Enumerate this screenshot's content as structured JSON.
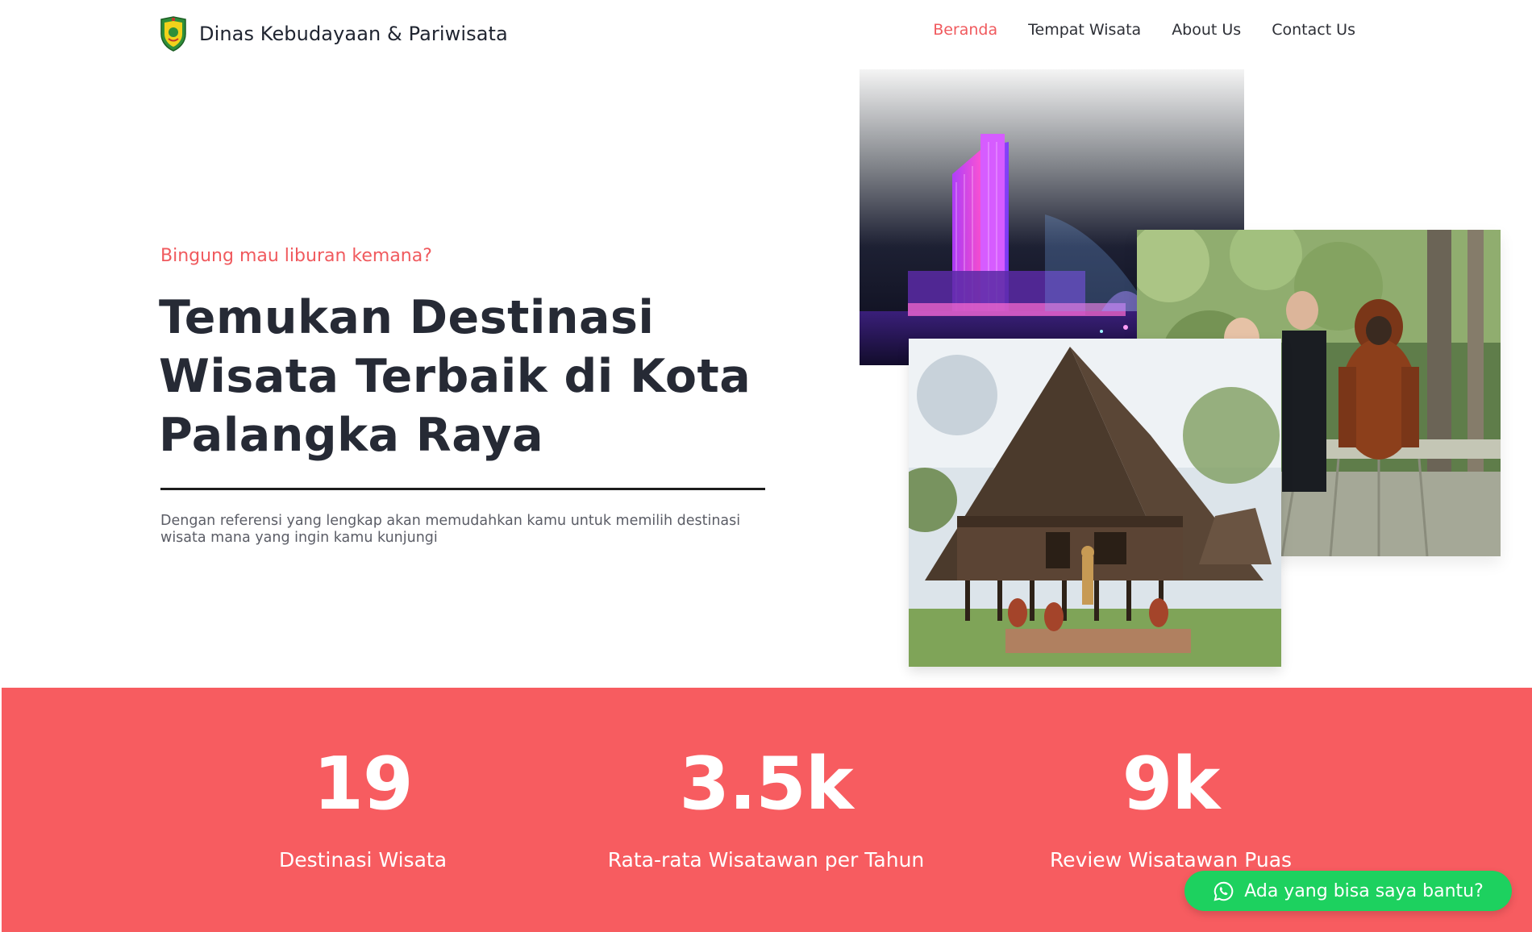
{
  "header": {
    "brand_name": "Dinas Kebudayaan & Pariwisata",
    "nav": [
      {
        "label": "Beranda",
        "active": true
      },
      {
        "label": "Tempat Wisata",
        "active": false
      },
      {
        "label": "About Us",
        "active": false
      },
      {
        "label": "Contact Us",
        "active": false
      }
    ]
  },
  "hero": {
    "eyebrow": "Bingung mau liburan kemana?",
    "title": "Temukan Destinasi Wisata Terbaik di Kota Palangka Raya",
    "description": "Dengan referensi yang lengkap akan memudahkan kamu untuk memilih destinasi wisata mana yang ingin kamu kunjungi"
  },
  "stats": [
    {
      "value": "19",
      "label": "Destinasi Wisata"
    },
    {
      "value": "3.5k",
      "label": "Rata-rata Wisatawan per Tahun"
    },
    {
      "value": "9k",
      "label": "Review Wisatawan Puas"
    }
  ],
  "whatsapp": {
    "label": "Ada yang bisa saya bantu?"
  },
  "colors": {
    "accent": "#f75c60",
    "nav_active": "#f05a5e",
    "whatsapp": "#1dd15f",
    "text_dark": "#262a35"
  },
  "icons": {
    "logo": "city-emblem-icon",
    "whatsapp": "whatsapp-icon"
  }
}
